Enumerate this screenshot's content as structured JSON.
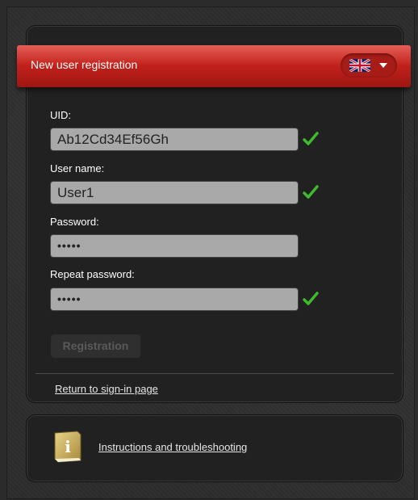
{
  "header": {
    "title": "New user registration",
    "language": "UK flag"
  },
  "form": {
    "uid": {
      "label": "UID:",
      "value": "Ab12Cd34Ef56Gh",
      "valid": true
    },
    "username": {
      "label": "User name:",
      "value": "User1",
      "valid": true
    },
    "password": {
      "label": "Password:",
      "value": "•••••",
      "valid": false
    },
    "repeat_password": {
      "label": "Repeat password:",
      "value": "•••••",
      "valid": true
    },
    "submit_label": "Registration"
  },
  "links": {
    "return": "Return to sign-in page",
    "help": "Instructions and troubleshooting"
  },
  "icons": {
    "check": "check-icon",
    "flag": "uk-flag-icon",
    "info": "info-book-icon"
  },
  "colors": {
    "accent_red": "#c4211b",
    "check_green": "#3dbb2c",
    "input_bg": "#a9a9a9"
  }
}
